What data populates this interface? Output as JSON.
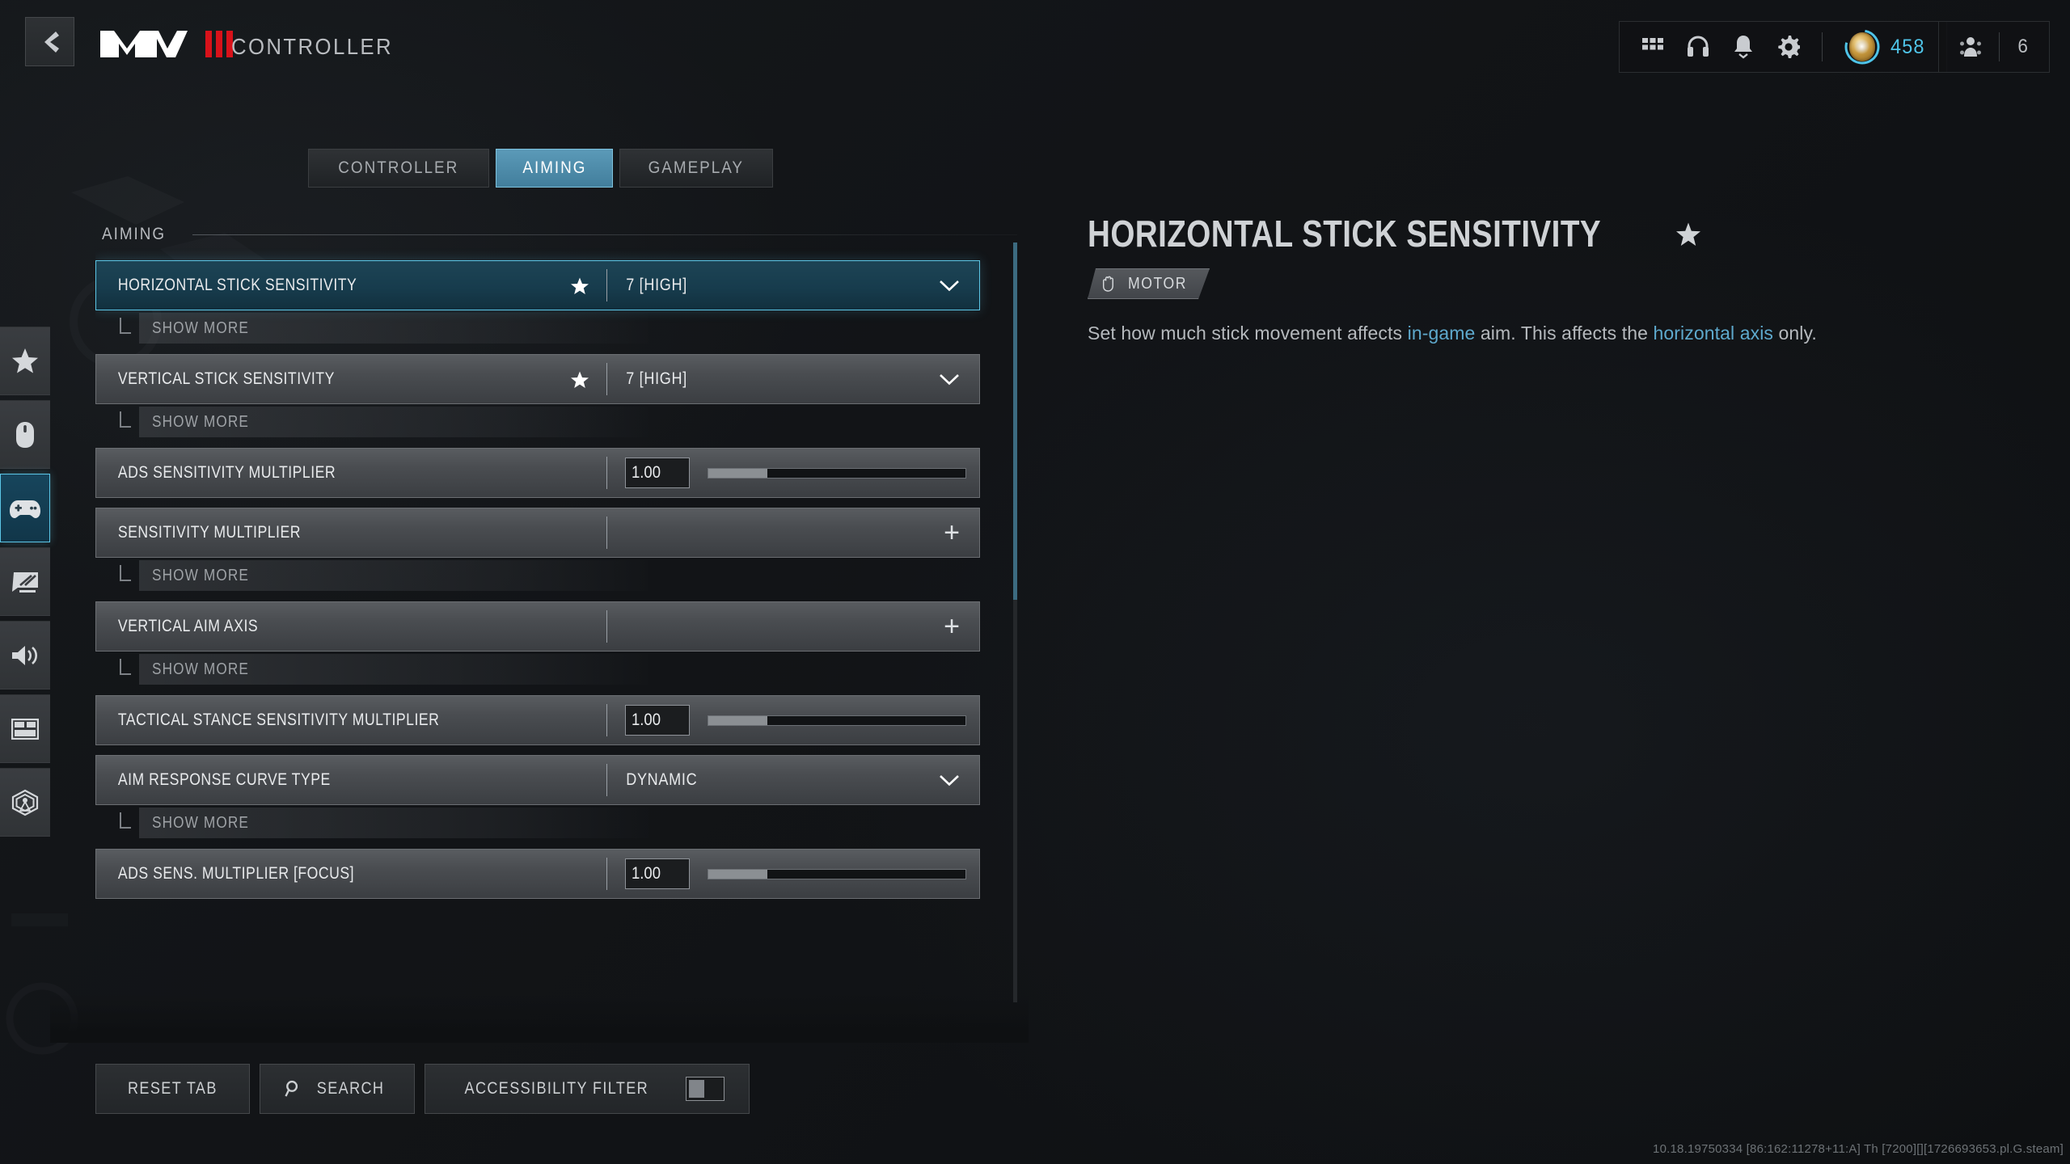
{
  "header": {
    "back_icon": "chevron-left-icon",
    "logo_text": "MW",
    "logo_bars": 3,
    "title": "CONTROLLER"
  },
  "hud": {
    "icons": [
      {
        "name": "grid-apps-icon"
      },
      {
        "name": "headset-icon"
      },
      {
        "name": "bell-notifications-icon"
      },
      {
        "name": "gear-settings-icon"
      }
    ],
    "rank": {
      "icon": "rank-medal-icon",
      "count": "458"
    },
    "squad": {
      "icon": "squad-icon",
      "count": "6"
    }
  },
  "rail": {
    "items": [
      {
        "name": "sidebar-item-favorites",
        "icon": "star-icon",
        "active": false
      },
      {
        "name": "sidebar-item-mouse-keyboard",
        "icon": "mouse-icon",
        "active": false
      },
      {
        "name": "sidebar-item-controller",
        "icon": "gamepad-icon",
        "active": true
      },
      {
        "name": "sidebar-item-graphics",
        "icon": "monitor-icon",
        "active": false
      },
      {
        "name": "sidebar-item-audio",
        "icon": "speaker-icon",
        "active": false
      },
      {
        "name": "sidebar-item-interface",
        "icon": "layout-panel-icon",
        "active": false
      },
      {
        "name": "sidebar-item-account-network",
        "icon": "radar-broadcast-icon",
        "active": false
      }
    ]
  },
  "tabs": [
    {
      "label": "CONTROLLER",
      "active": false
    },
    {
      "label": "AIMING",
      "active": true
    },
    {
      "label": "GAMEPLAY",
      "active": false
    }
  ],
  "list": {
    "section_title": "AIMING",
    "rows": [
      {
        "type": "dropdown",
        "label": "HORIZONTAL STICK SENSITIVITY",
        "value": "7 [HIGH]",
        "favorite": true,
        "selected": true,
        "show_more": "SHOW MORE"
      },
      {
        "type": "dropdown",
        "label": "VERTICAL STICK SENSITIVITY",
        "value": "7 [HIGH]",
        "favorite": true,
        "selected": false,
        "show_more": "SHOW MORE"
      },
      {
        "type": "slider",
        "label": "ADS SENSITIVITY MULTIPLIER",
        "value": "1.00",
        "fill_percent": 23,
        "favorite": false,
        "selected": false,
        "show_more": null
      },
      {
        "type": "expand",
        "label": "SENSITIVITY MULTIPLIER",
        "value": "",
        "favorite": false,
        "selected": false,
        "show_more": "SHOW MORE"
      },
      {
        "type": "expand",
        "label": "VERTICAL AIM AXIS",
        "value": "",
        "favorite": false,
        "selected": false,
        "show_more": "SHOW MORE"
      },
      {
        "type": "slider",
        "label": "TACTICAL STANCE SENSITIVITY MULTIPLIER",
        "value": "1.00",
        "fill_percent": 23,
        "favorite": false,
        "selected": false,
        "show_more": null
      },
      {
        "type": "dropdown",
        "label": "AIM RESPONSE CURVE TYPE",
        "value": "DYNAMIC",
        "favorite": false,
        "selected": false,
        "show_more": "SHOW MORE"
      },
      {
        "type": "slider",
        "label": "ADS SENS. MULTIPLIER [FOCUS]",
        "value": "1.00",
        "fill_percent": 23,
        "favorite": false,
        "selected": false,
        "show_more": null
      }
    ],
    "scroll_thumb_percent": 47
  },
  "detail": {
    "title": "HORIZONTAL STICK SENSITIVITY",
    "favorite_icon": "star-icon",
    "badge": {
      "icon": "hand-motor-icon",
      "label": "MOTOR"
    },
    "description_parts": [
      {
        "text": "Set how much stick movement affects ",
        "highlight": false
      },
      {
        "text": "in-game",
        "highlight": true
      },
      {
        "text": " aim. This affects the ",
        "highlight": false
      },
      {
        "text": "horizontal axis",
        "highlight": true
      },
      {
        "text": " only.",
        "highlight": false
      }
    ]
  },
  "bottom": {
    "reset_label": "RESET TAB",
    "search_label": "SEARCH",
    "search_icon": "search-icon",
    "accessibility_label": "ACCESSIBILITY FILTER",
    "accessibility_on": false
  },
  "build_string": "10.18.19750334 [86:162:11278+11:A] Th [7200][][1726693653.pl.G.steam]",
  "colors": {
    "accent_cyan": "#5cc6e6",
    "tab_active": "#5b9ab8",
    "logo_red": "#d8121a",
    "rank_blue": "#4fc4e8",
    "link_blue": "#5ea9cd"
  }
}
